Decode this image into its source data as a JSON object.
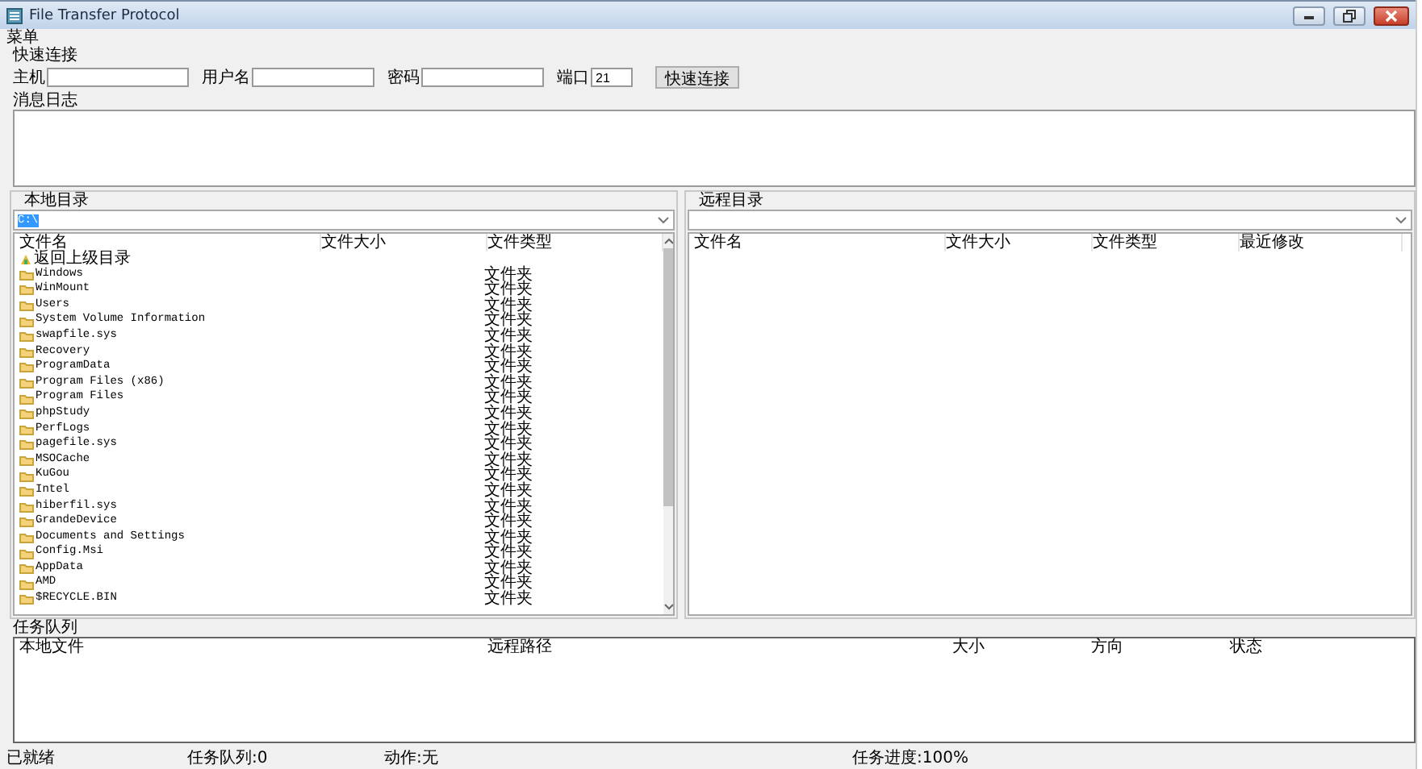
{
  "window": {
    "title": "File Transfer Protocol"
  },
  "menu": [
    "菜单"
  ],
  "quick_connect": {
    "title": "快速连接",
    "fields": [
      {
        "label": "主机"
      },
      {
        "label": "用户名"
      },
      {
        "label": "密码"
      },
      {
        "label": "端口",
        "value": "21"
      }
    ],
    "button": "快速连接"
  },
  "log": {
    "title": "消息日志"
  },
  "local": {
    "title": "本地目录",
    "path": "C:\\",
    "columns": [
      "文件名",
      "文件大小",
      "文件类型"
    ],
    "rows": [
      {
        "kind": "parent",
        "name": "返回上级目录"
      },
      {
        "kind": "folder",
        "name": "Windows",
        "type": "文件夹"
      },
      {
        "kind": "folder",
        "name": "WinMount",
        "type": "文件夹"
      },
      {
        "kind": "folder",
        "name": "Users",
        "type": "文件夹"
      },
      {
        "kind": "folder",
        "name": "System Volume Information",
        "type": "文件夹"
      },
      {
        "kind": "folder",
        "name": "swapfile.sys",
        "type": "文件夹"
      },
      {
        "kind": "folder",
        "name": "Recovery",
        "type": "文件夹"
      },
      {
        "kind": "folder",
        "name": "ProgramData",
        "type": "文件夹"
      },
      {
        "kind": "folder",
        "name": "Program Files (x86)",
        "type": "文件夹"
      },
      {
        "kind": "folder",
        "name": "Program Files",
        "type": "文件夹"
      },
      {
        "kind": "folder",
        "name": "phpStudy",
        "type": "文件夹"
      },
      {
        "kind": "folder",
        "name": "PerfLogs",
        "type": "文件夹"
      },
      {
        "kind": "folder",
        "name": "pagefile.sys",
        "type": "文件夹"
      },
      {
        "kind": "folder",
        "name": "MSOCache",
        "type": "文件夹"
      },
      {
        "kind": "folder",
        "name": "KuGou",
        "type": "文件夹"
      },
      {
        "kind": "folder",
        "name": "Intel",
        "type": "文件夹"
      },
      {
        "kind": "folder",
        "name": "hiberfil.sys",
        "type": "文件夹"
      },
      {
        "kind": "folder",
        "name": "GrandeDevice",
        "type": "文件夹"
      },
      {
        "kind": "folder",
        "name": "Documents and Settings",
        "type": "文件夹"
      },
      {
        "kind": "folder",
        "name": "Config.Msi",
        "type": "文件夹"
      },
      {
        "kind": "folder",
        "name": "AppData",
        "type": "文件夹"
      },
      {
        "kind": "folder",
        "name": "AMD",
        "type": "文件夹"
      },
      {
        "kind": "folder",
        "name": "$RECYCLE.BIN",
        "type": "文件夹"
      }
    ]
  },
  "remote": {
    "title": "远程目录",
    "columns": [
      "文件名",
      "文件大小",
      "文件类型",
      "最近修改"
    ]
  },
  "queue": {
    "title": "任务队列",
    "columns": [
      "本地文件",
      "远程路径",
      "大小",
      "方向",
      "状态"
    ]
  },
  "status_bar": [
    "已就绪",
    "任务队列:0",
    "动作:无",
    "任务进度:100%"
  ]
}
